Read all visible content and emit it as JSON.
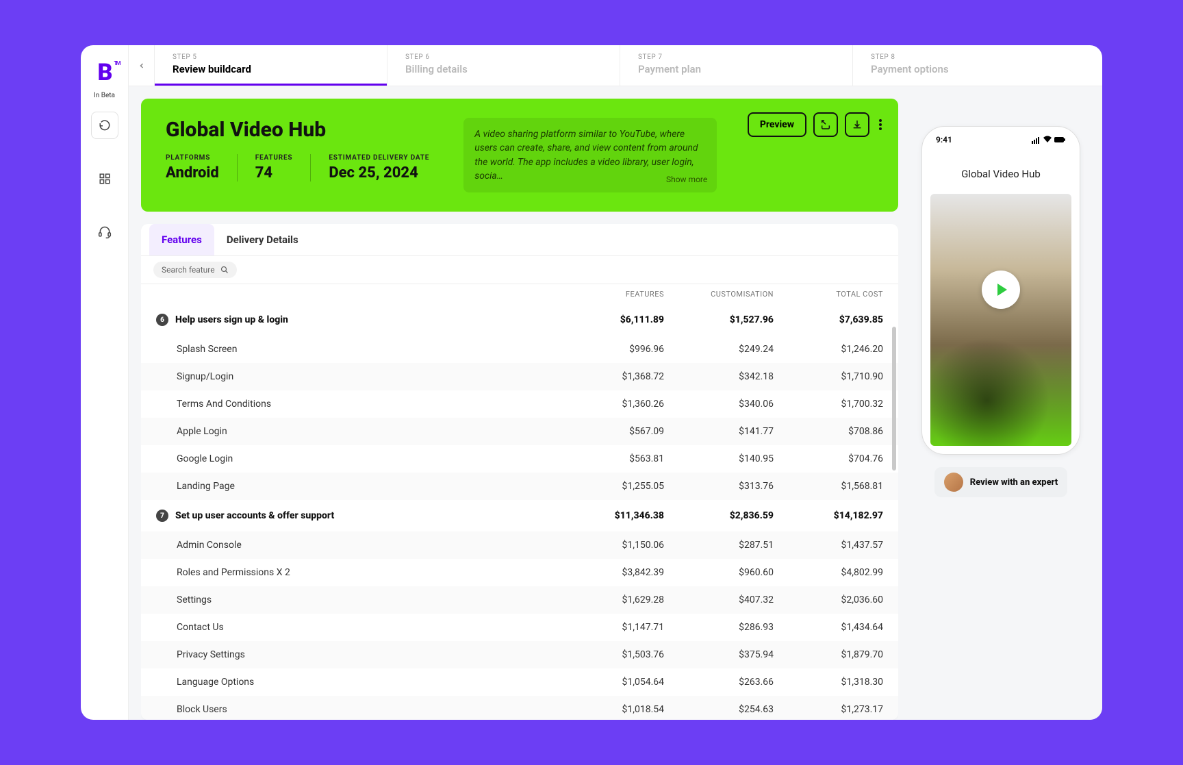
{
  "logo": {
    "tm": "TM",
    "subtitle": "In Beta"
  },
  "steps": [
    {
      "num": "STEP 5",
      "label": "Review buildcard",
      "active": true
    },
    {
      "num": "STEP 6",
      "label": "Billing details",
      "active": false
    },
    {
      "num": "STEP 7",
      "label": "Payment plan",
      "active": false
    },
    {
      "num": "STEP 8",
      "label": "Payment options",
      "active": false
    }
  ],
  "hero": {
    "title": "Global Video Hub",
    "platforms_label": "PLATFORMS",
    "platforms": "Android",
    "features_label": "FEATURES",
    "features": "74",
    "delivery_label": "ESTIMATED DELIVERY DATE",
    "delivery": "Dec 25, 2024",
    "desc": "A video sharing platform similar to YouTube, where users can create, share, and view content from around the world. The app includes a video library, user login, socia…",
    "show_more": "Show more"
  },
  "actions": {
    "preview": "Preview"
  },
  "tabs": {
    "features": "Features",
    "delivery": "Delivery Details"
  },
  "search_placeholder": "Search feature",
  "columns": {
    "features": "FEATURES",
    "custom": "CUSTOMISATION",
    "total": "TOTAL COST"
  },
  "groups": [
    {
      "count": "6",
      "title": "Help users sign up & login",
      "f": "$6,111.89",
      "c": "$1,527.96",
      "t": "$7,639.85",
      "rows": [
        {
          "name": "Splash Screen",
          "f": "$996.96",
          "c": "$249.24",
          "t": "$1,246.20"
        },
        {
          "name": "Signup/Login",
          "f": "$1,368.72",
          "c": "$342.18",
          "t": "$1,710.90"
        },
        {
          "name": "Terms And Conditions",
          "f": "$1,360.26",
          "c": "$340.06",
          "t": "$1,700.32"
        },
        {
          "name": "Apple Login",
          "f": "$567.09",
          "c": "$141.77",
          "t": "$708.86"
        },
        {
          "name": "Google Login",
          "f": "$563.81",
          "c": "$140.95",
          "t": "$704.76"
        },
        {
          "name": "Landing Page",
          "f": "$1,255.05",
          "c": "$313.76",
          "t": "$1,568.81"
        }
      ]
    },
    {
      "count": "7",
      "title": "Set up user accounts & offer support",
      "f": "$11,346.38",
      "c": "$2,836.59",
      "t": "$14,182.97",
      "rows": [
        {
          "name": "Admin Console",
          "f": "$1,150.06",
          "c": "$287.51",
          "t": "$1,437.57"
        },
        {
          "name": "Roles and Permissions X 2",
          "f": "$3,842.39",
          "c": "$960.60",
          "t": "$4,802.99"
        },
        {
          "name": "Settings",
          "f": "$1,629.28",
          "c": "$407.32",
          "t": "$2,036.60"
        },
        {
          "name": "Contact Us",
          "f": "$1,147.71",
          "c": "$286.93",
          "t": "$1,434.64"
        },
        {
          "name": "Privacy Settings",
          "f": "$1,503.76",
          "c": "$375.94",
          "t": "$1,879.70"
        },
        {
          "name": "Language Options",
          "f": "$1,054.64",
          "c": "$263.66",
          "t": "$1,318.30"
        },
        {
          "name": "Block Users",
          "f": "$1,018.54",
          "c": "$254.63",
          "t": "$1,273.17"
        }
      ]
    }
  ],
  "phone": {
    "time": "9:41",
    "title": "Global Video Hub"
  },
  "expert": "Review with an expert"
}
